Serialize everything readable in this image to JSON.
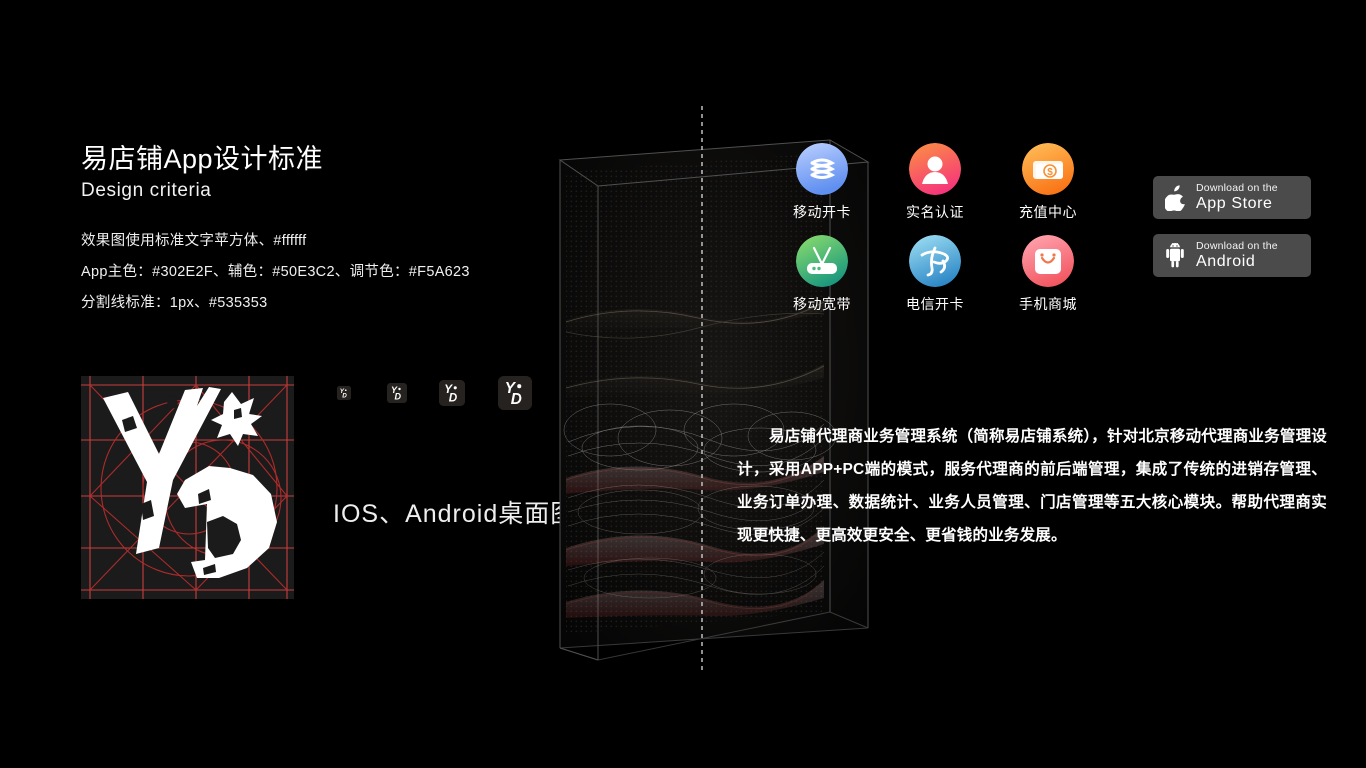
{
  "heading": {
    "title_cn": "易店铺App设计标准",
    "title_en": "Design criteria"
  },
  "specs": [
    "效果图使用标准文字苹方体、#ffffff",
    "App主色：#302E2F、辅色：#50E3C2、调节色：#F5A623",
    "分割线标准：1px、#535353"
  ],
  "colors": {
    "app_primary": "#302E2F",
    "app_secondary": "#50E3C2",
    "app_accent": "#F5A623",
    "text": "#ffffff",
    "divider": "#535353",
    "background": "#000000",
    "guide_red": "#c62828",
    "badge_gray": "#4b4b4b"
  },
  "logo": {
    "letters": "YD",
    "tile_background": "#1b1b1b",
    "grid_color": "#d94040"
  },
  "icon_ramp": {
    "caption": "IOS、Android桌面图标",
    "sizes": [
      14,
      20,
      26,
      34,
      40
    ]
  },
  "app_icons": [
    {
      "label": "移动开卡",
      "icon": "china-mobile-icon",
      "c1": "#aec6ff",
      "c2": "#5f8ff0"
    },
    {
      "label": "实名认证",
      "icon": "user-verify-icon",
      "c1": "#fb8c45",
      "c2": "#f6337c"
    },
    {
      "label": "充值中心",
      "icon": "wallet-recharge-icon",
      "c1": "#ffb347",
      "c2": "#f97316"
    },
    {
      "label": "移动宽带",
      "icon": "router-broadband-icon",
      "c1": "#7fd06a",
      "c2": "#1f9e85"
    },
    {
      "label": "电信开卡",
      "icon": "china-telecom-icon",
      "c1": "#8fd4ef",
      "c2": "#2b86c5"
    },
    {
      "label": "手机商城",
      "icon": "shop-bag-icon",
      "c1": "#ff9aa8",
      "c2": "#f2555f"
    }
  ],
  "store_badges": [
    {
      "top": "Download on the",
      "main": "App Store",
      "glyph": "apple-icon"
    },
    {
      "top": "Download on the",
      "main": "Android",
      "glyph": "android-icon"
    }
  ],
  "description": "易店铺代理商业务管理系统（简称易店铺系统），针对北京移动代理商业务管理设计，采用APP+PC端的模式，服务代理商的前后端管理，集成了传统的进销存管理、业务订单办理、数据统计、业务人员管理、门店管理等五大核心模块。帮助代理商实现更快捷、更高效更安全、更省钱的业务发展。"
}
